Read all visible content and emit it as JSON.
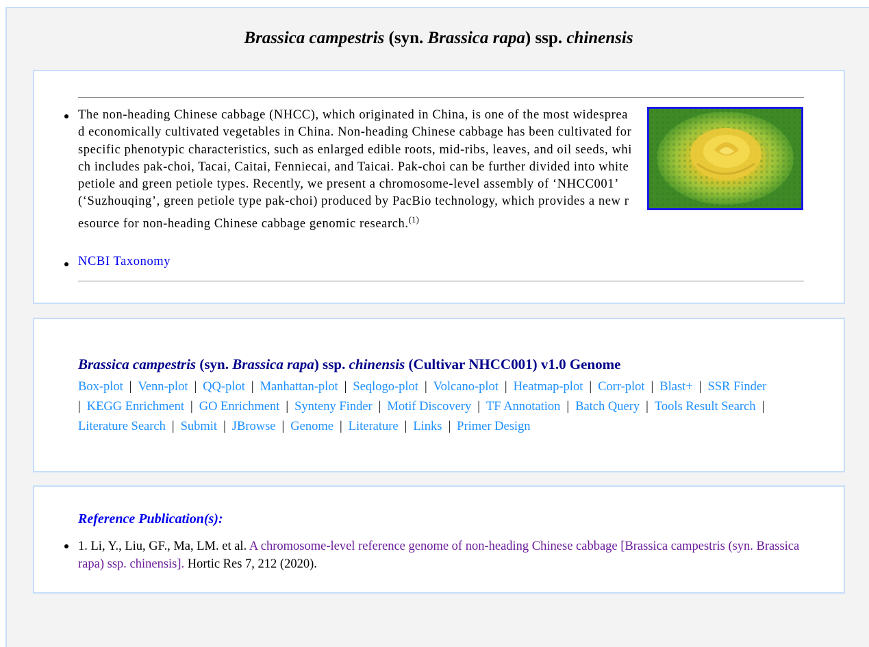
{
  "page_title": {
    "genus1": "Brassica campestris",
    "syn_open": " (syn. ",
    "genus2": "Brassica rapa",
    "ssp": ") ssp. ",
    "subspecies": "chinensis"
  },
  "intro": {
    "description": "The non-heading Chinese cabbage (NHCC), which originated in China, is one of the most widespread economically cultivated vegetables in China. Non-heading Chinese cabbage has been cultivated for specific phenotypic characteristics, such as enlarged edible roots, mid-ribs, leaves, and oil seeds, which includes pak-choi, Tacai, Caitai, Fenniecai, and Taicai. Pak-choi can be further divided into white petiole and green petiole types. Recently, we present a chromosome-level assembly of ‘NHCC001’ (‘Suzhouqing’, green petiole type pak-choi) produced by PacBio technology, which provides a new resource for non-heading Chinese cabbage genomic research.",
    "footnote": "(1)",
    "ncbi_link": "NCBI Taxonomy",
    "photo_icon": "cabbage-photo"
  },
  "genome": {
    "genus1": "Brassica campestris",
    "syn_open": " (syn. ",
    "genus2": "Brassica rapa",
    "ssp": ") ssp. ",
    "subspecies": "chinensis",
    "suffix": " (Cultivar NHCC001) v1.0 Genome",
    "tools": [
      "Box-plot",
      "Venn-plot",
      "QQ-plot",
      "Manhattan-plot",
      "Seqlogo-plot",
      "Volcano-plot",
      "Heatmap-plot",
      "Corr-plot",
      "Blast+",
      "SSR Finder",
      "KEGG Enrichment",
      "GO Enrichment",
      "Synteny Finder",
      "Motif Discovery",
      "TF Annotation",
      "Batch Query",
      "Tools Result Search",
      "Literature Search",
      "Submit",
      "JBrowse",
      "Genome",
      "Literature",
      "Links",
      "Primer Design"
    ],
    "separator": "|"
  },
  "reference": {
    "heading": "Reference Publication(s):",
    "authors": "1. Li, Y., Liu, GF., Ma, LM. et al. ",
    "link_text": "A chromosome-level reference genome of non-heading Chinese cabbage [Brassica campestris (syn. Brassica rapa) ssp. chinensis].",
    "journal": " Hortic Res 7, 212 (2020)."
  },
  "colors": {
    "tool_link": "#1e90ff",
    "genome_title": "#00008b",
    "reference_heading": "#0000ee",
    "visited_link": "#6a1b9a",
    "panel_border": "#c6defa"
  }
}
